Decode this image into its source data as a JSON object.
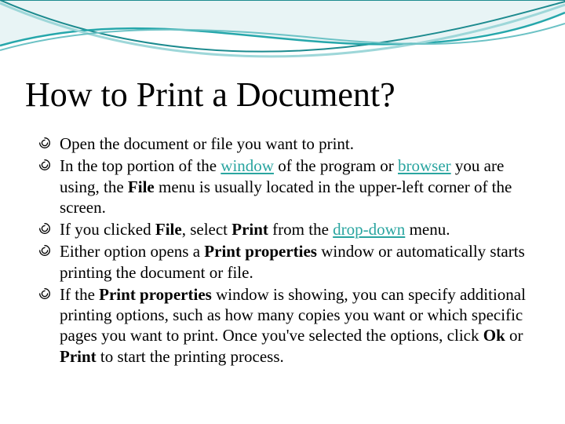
{
  "title": "How to Print a Document?",
  "bullets": {
    "b1": {
      "text": "Open the document or file you want to print."
    },
    "b2": {
      "t1": "In the top portion of the ",
      "link1": "window",
      "t2": " of the program or ",
      "link2": "browser",
      "t3": " you are using, the ",
      "bold1": "File",
      "t4": " menu is usually located in the upper-left corner of the screen."
    },
    "b3": {
      "t1": "If you clicked ",
      "bold1": "File",
      "t2": ", select ",
      "bold2": "Print",
      "t3": " from the ",
      "link1": "drop-down",
      "t4": " menu."
    },
    "b4": {
      "t1": "Either option opens a ",
      "bold1": "Print properties",
      "t2": " window or automatically starts printing the document or file."
    },
    "b5": {
      "t1": "If the ",
      "bold1": "Print properties",
      "t2": " window is showing, you can specify additional printing options, such as how many copies you want or which specific pages you want to print. Once you've selected the options, click ",
      "bold2": "Ok",
      "t3": " or ",
      "bold3": "Print",
      "t4": " to start the printing process."
    }
  }
}
